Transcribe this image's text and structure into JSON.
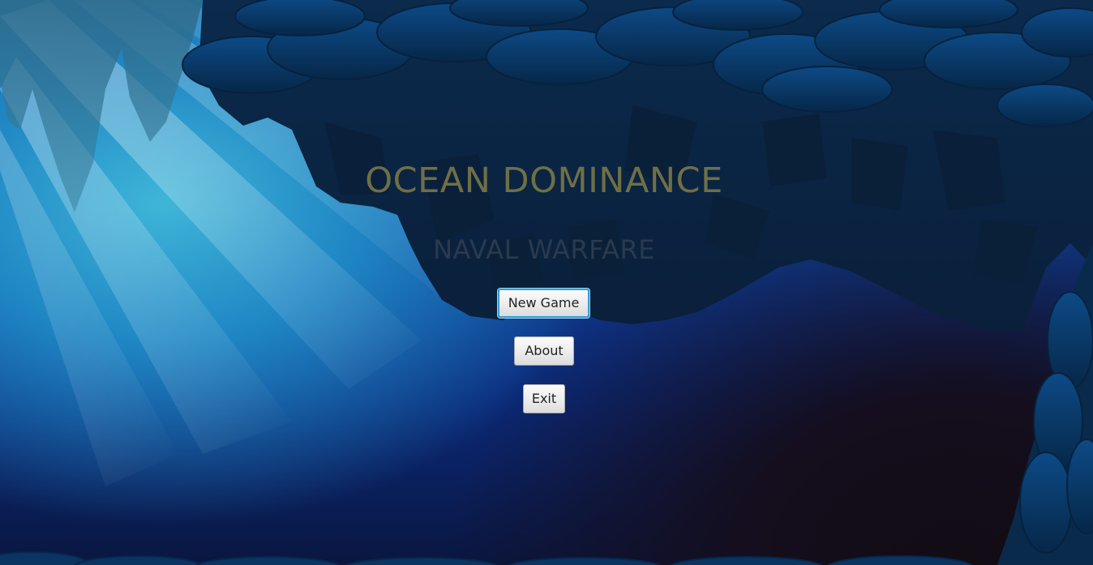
{
  "game": {
    "title": "OCEAN DOMINANCE",
    "subtitle": "NAVAL WARFARE"
  },
  "menu": {
    "new_game_label": "New Game",
    "about_label": "About",
    "exit_label": "Exit",
    "focused_item": "New Game"
  },
  "colors": {
    "title": "#6f6f47",
    "subtitle": "#2b3a4c",
    "button_focus_ring": "#2f9ed6",
    "water_light": "#3fb6d8",
    "water_deep": "#0b2a7a",
    "cave_rock": "#0b2542"
  }
}
